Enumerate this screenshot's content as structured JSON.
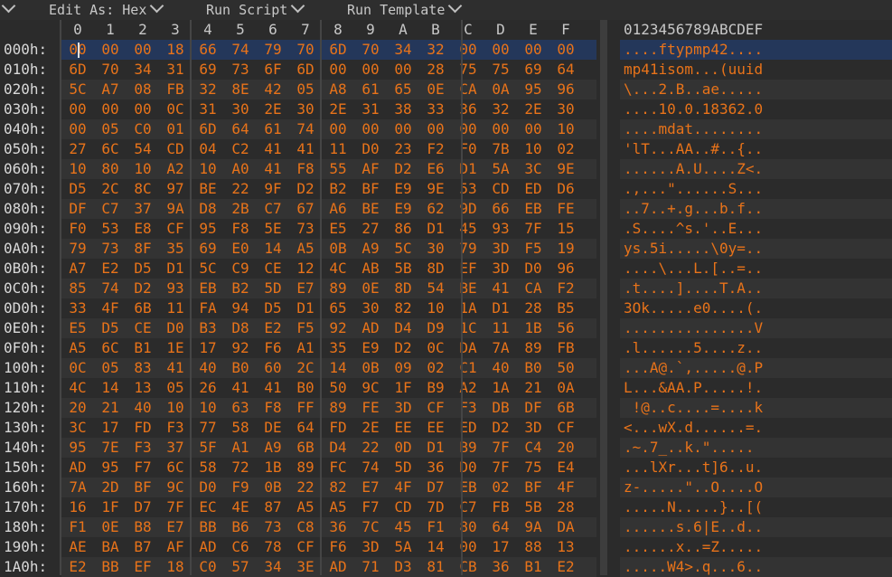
{
  "toolbar": {
    "edit_as": "Edit As: Hex",
    "run_script": "Run Script",
    "run_template": "Run Template"
  },
  "columns": [
    "0",
    "1",
    "2",
    "3",
    "4",
    "5",
    "6",
    "7",
    "8",
    "9",
    "A",
    "B",
    "C",
    "D",
    "E",
    "F"
  ],
  "ascii_header": "0123456789ABCDEF",
  "rows": [
    {
      "addr": "000h:",
      "hex": [
        "00",
        "00",
        "00",
        "18",
        "66",
        "74",
        "79",
        "70",
        "6D",
        "70",
        "34",
        "32",
        "00",
        "00",
        "00",
        "00"
      ],
      "ascii": "....ftypmp42...."
    },
    {
      "addr": "010h:",
      "hex": [
        "6D",
        "70",
        "34",
        "31",
        "69",
        "73",
        "6F",
        "6D",
        "00",
        "00",
        "00",
        "28",
        "75",
        "75",
        "69",
        "64"
      ],
      "ascii": "mp41isom...(uuid"
    },
    {
      "addr": "020h:",
      "hex": [
        "5C",
        "A7",
        "08",
        "FB",
        "32",
        "8E",
        "42",
        "05",
        "A8",
        "61",
        "65",
        "0E",
        "CA",
        "0A",
        "95",
        "96"
      ],
      "ascii": "\\...2.B..ae....."
    },
    {
      "addr": "030h:",
      "hex": [
        "00",
        "00",
        "00",
        "0C",
        "31",
        "30",
        "2E",
        "30",
        "2E",
        "31",
        "38",
        "33",
        "36",
        "32",
        "2E",
        "30"
      ],
      "ascii": "....10.0.18362.0"
    },
    {
      "addr": "040h:",
      "hex": [
        "00",
        "05",
        "C0",
        "01",
        "6D",
        "64",
        "61",
        "74",
        "00",
        "00",
        "00",
        "00",
        "00",
        "00",
        "00",
        "10"
      ],
      "ascii": "....mdat........"
    },
    {
      "addr": "050h:",
      "hex": [
        "27",
        "6C",
        "54",
        "CD",
        "04",
        "C2",
        "41",
        "41",
        "11",
        "D0",
        "23",
        "F2",
        "F0",
        "7B",
        "10",
        "02"
      ],
      "ascii": "'lT...AA..#..{.."
    },
    {
      "addr": "060h:",
      "hex": [
        "10",
        "80",
        "10",
        "A2",
        "10",
        "A0",
        "41",
        "F8",
        "55",
        "AF",
        "D2",
        "E6",
        "D1",
        "5A",
        "3C",
        "9E"
      ],
      "ascii": "......A.U....Z<."
    },
    {
      "addr": "070h:",
      "hex": [
        "D5",
        "2C",
        "8C",
        "97",
        "BE",
        "22",
        "9F",
        "D2",
        "B2",
        "BF",
        "E9",
        "9E",
        "53",
        "CD",
        "ED",
        "D6"
      ],
      "ascii": ".,...\"......S..."
    },
    {
      "addr": "080h:",
      "hex": [
        "DF",
        "C7",
        "37",
        "9A",
        "D8",
        "2B",
        "C7",
        "67",
        "A6",
        "BE",
        "E9",
        "62",
        "9D",
        "66",
        "EB",
        "FE"
      ],
      "ascii": "..7..+.g...b.f.."
    },
    {
      "addr": "090h:",
      "hex": [
        "F0",
        "53",
        "E8",
        "CF",
        "95",
        "F8",
        "5E",
        "73",
        "E5",
        "27",
        "86",
        "D1",
        "45",
        "93",
        "7F",
        "15"
      ],
      "ascii": ".S....^s.'..E..."
    },
    {
      "addr": "0A0h:",
      "hex": [
        "79",
        "73",
        "8F",
        "35",
        "69",
        "E0",
        "14",
        "A5",
        "0B",
        "A9",
        "5C",
        "30",
        "79",
        "3D",
        "F5",
        "19"
      ],
      "ascii": "ys.5i.....\\0y=.."
    },
    {
      "addr": "0B0h:",
      "hex": [
        "A7",
        "E2",
        "D5",
        "D1",
        "5C",
        "C9",
        "CE",
        "12",
        "4C",
        "AB",
        "5B",
        "8D",
        "EF",
        "3D",
        "D0",
        "96"
      ],
      "ascii": "....\\...L.[..=.."
    },
    {
      "addr": "0C0h:",
      "hex": [
        "85",
        "74",
        "D2",
        "93",
        "EB",
        "B2",
        "5D",
        "E7",
        "89",
        "0E",
        "8D",
        "54",
        "BE",
        "41",
        "CA",
        "F2"
      ],
      "ascii": ".t....]....T.A.."
    },
    {
      "addr": "0D0h:",
      "hex": [
        "33",
        "4F",
        "6B",
        "11",
        "FA",
        "94",
        "D5",
        "D1",
        "65",
        "30",
        "82",
        "10",
        "1A",
        "D1",
        "28",
        "B5"
      ],
      "ascii": "3Ok.....e0....(."
    },
    {
      "addr": "0E0h:",
      "hex": [
        "E5",
        "D5",
        "CE",
        "D0",
        "B3",
        "D8",
        "E2",
        "F5",
        "92",
        "AD",
        "D4",
        "D9",
        "1C",
        "11",
        "1B",
        "56"
      ],
      "ascii": "...............V"
    },
    {
      "addr": "0F0h:",
      "hex": [
        "A5",
        "6C",
        "B1",
        "1E",
        "17",
        "92",
        "F6",
        "A1",
        "35",
        "E9",
        "D2",
        "0C",
        "DA",
        "7A",
        "89",
        "FB"
      ],
      "ascii": ".l......5....z.."
    },
    {
      "addr": "100h:",
      "hex": [
        "0C",
        "05",
        "83",
        "41",
        "40",
        "B0",
        "60",
        "2C",
        "14",
        "0B",
        "09",
        "02",
        "C1",
        "40",
        "B0",
        "50"
      ],
      "ascii": "...A@.`,.....@.P"
    },
    {
      "addr": "110h:",
      "hex": [
        "4C",
        "14",
        "13",
        "05",
        "26",
        "41",
        "41",
        "B0",
        "50",
        "9C",
        "1F",
        "B9",
        "A2",
        "1A",
        "21",
        "0A"
      ],
      "ascii": "L...&AA.P.....!."
    },
    {
      "addr": "120h:",
      "hex": [
        "20",
        "21",
        "40",
        "10",
        "10",
        "63",
        "F8",
        "FF",
        "89",
        "FE",
        "3D",
        "CF",
        "F3",
        "DB",
        "DF",
        "6B"
      ],
      "ascii": " !@..c....=....k"
    },
    {
      "addr": "130h:",
      "hex": [
        "3C",
        "17",
        "FD",
        "F3",
        "77",
        "58",
        "DE",
        "64",
        "FD",
        "2E",
        "EE",
        "EE",
        "ED",
        "D2",
        "3D",
        "CF"
      ],
      "ascii": "<...wX.d......=."
    },
    {
      "addr": "140h:",
      "hex": [
        "95",
        "7E",
        "F3",
        "37",
        "5F",
        "A1",
        "A9",
        "6B",
        "D4",
        "22",
        "0D",
        "D1",
        "B9",
        "7F",
        "C4",
        "20"
      ],
      "ascii": ".~.7_..k.\"..... "
    },
    {
      "addr": "150h:",
      "hex": [
        "AD",
        "95",
        "F7",
        "6C",
        "58",
        "72",
        "1B",
        "89",
        "FC",
        "74",
        "5D",
        "36",
        "D0",
        "7F",
        "75",
        "E4"
      ],
      "ascii": "...lXr...t]6..u."
    },
    {
      "addr": "160h:",
      "hex": [
        "7A",
        "2D",
        "BF",
        "9C",
        "D0",
        "F9",
        "0B",
        "22",
        "82",
        "E7",
        "4F",
        "D7",
        "EB",
        "02",
        "BF",
        "4F"
      ],
      "ascii": "z-.....\"..O....O"
    },
    {
      "addr": "170h:",
      "hex": [
        "16",
        "1F",
        "D7",
        "7F",
        "EC",
        "4E",
        "87",
        "A5",
        "A5",
        "F7",
        "CD",
        "7D",
        "C7",
        "FB",
        "5B",
        "28"
      ],
      "ascii": ".....N.....}..[("
    },
    {
      "addr": "180h:",
      "hex": [
        "F1",
        "0E",
        "B8",
        "E7",
        "BB",
        "B6",
        "73",
        "C8",
        "36",
        "7C",
        "45",
        "F1",
        "80",
        "64",
        "9A",
        "DA"
      ],
      "ascii": "......s.6|E..d.."
    },
    {
      "addr": "190h:",
      "hex": [
        "AE",
        "BA",
        "B7",
        "AF",
        "AD",
        "C6",
        "78",
        "CF",
        "F6",
        "3D",
        "5A",
        "14",
        "00",
        "17",
        "88",
        "13"
      ],
      "ascii": "......x..=Z....."
    },
    {
      "addr": "1A0h:",
      "hex": [
        "E2",
        "BB",
        "EF",
        "18",
        "C0",
        "57",
        "34",
        "3E",
        "AD",
        "71",
        "D3",
        "81",
        "CB",
        "36",
        "B1",
        "E2"
      ],
      "ascii": ".....W4>.q...6.."
    }
  ]
}
